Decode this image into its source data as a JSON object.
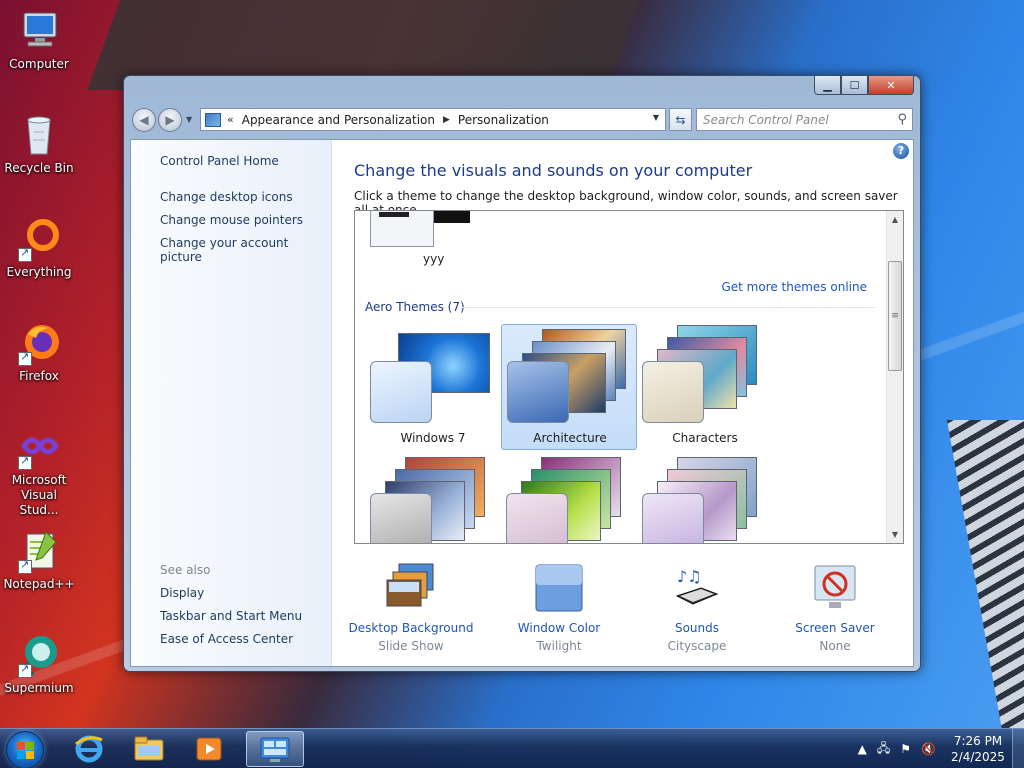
{
  "desktop": {
    "icons": [
      {
        "label": "Computer",
        "icon": "computer-icon"
      },
      {
        "label": "Recycle Bin",
        "icon": "recycle-bin-icon"
      },
      {
        "label": "Everything",
        "icon": "everything-icon"
      },
      {
        "label": "Firefox",
        "icon": "firefox-icon"
      },
      {
        "label": "Microsoft Visual Stud...",
        "icon": "visual-studio-icon"
      },
      {
        "label": "Notepad++",
        "icon": "notepad-plus-plus-icon"
      },
      {
        "label": "Supermium",
        "icon": "supermium-icon"
      }
    ]
  },
  "window": {
    "address": {
      "chevron": "«",
      "crumbs": [
        "Appearance and Personalization",
        "Personalization"
      ]
    },
    "search": {
      "placeholder": "Search Control Panel"
    },
    "left_pane": {
      "home": "Control Panel Home",
      "links": [
        "Change desktop icons",
        "Change mouse pointers",
        "Change your account picture"
      ],
      "see_also_label": "See also",
      "see_also": [
        "Display",
        "Taskbar and Start Menu",
        "Ease of Access Center"
      ]
    },
    "title": "Change the visuals and sounds on your computer",
    "subtitle": "Click a theme to change the desktop background, window color, sounds, and screen saver all at once.",
    "my_theme_label": "yyy",
    "get_more": "Get more themes online",
    "aero_group": "Aero Themes (7)",
    "themes": [
      {
        "name": "Windows 7",
        "selected": false
      },
      {
        "name": "Architecture",
        "selected": true
      },
      {
        "name": "Characters",
        "selected": false
      },
      {
        "name": "",
        "selected": false
      },
      {
        "name": "",
        "selected": false
      },
      {
        "name": "",
        "selected": false
      }
    ],
    "bottom": [
      {
        "label": "Desktop Background",
        "sub": "Slide Show",
        "icon": "desktop-background-icon"
      },
      {
        "label": "Window Color",
        "sub": "Twilight",
        "icon": "window-color-icon"
      },
      {
        "label": "Sounds",
        "sub": "Cityscape",
        "icon": "sounds-icon"
      },
      {
        "label": "Screen Saver",
        "sub": "None",
        "icon": "screen-saver-icon"
      }
    ]
  },
  "taskbar": {
    "pinned": [
      "internet-explorer-icon",
      "file-explorer-icon",
      "media-player-icon",
      "control-panel-icon"
    ],
    "time": "7:26 PM",
    "date": "2/4/2025"
  },
  "colors": {
    "link": "#1e56b8",
    "heading": "#1e3a8a",
    "selection": "#c4ddf8"
  }
}
